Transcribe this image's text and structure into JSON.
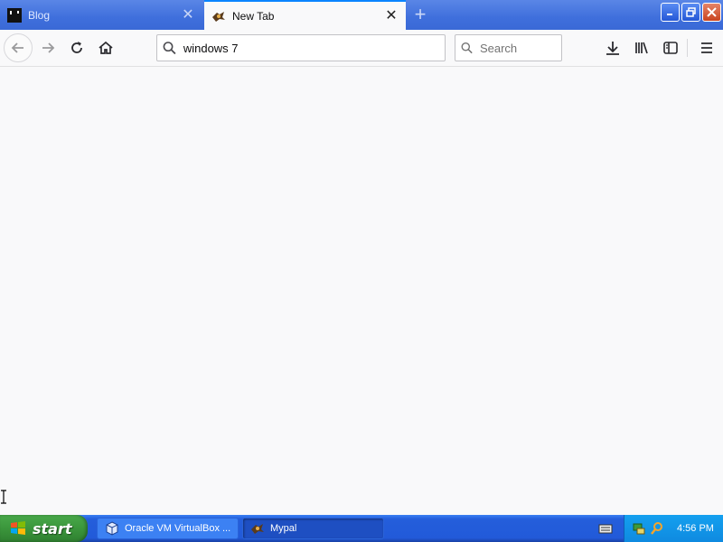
{
  "browser": {
    "tabs": [
      {
        "label": "Blog",
        "active": false,
        "icon": "blog-favicon"
      },
      {
        "label": "New Tab",
        "active": true,
        "icon": "mypal-favicon"
      }
    ],
    "urlbar": {
      "value": "windows 7"
    },
    "searchbar": {
      "placeholder": "Search"
    }
  },
  "taskbar": {
    "start_label": "start",
    "tasks": [
      {
        "label": "Oracle VM VirtualBox ...",
        "icon": "virtualbox-icon"
      },
      {
        "label": "Mypal",
        "icon": "mypal-icon",
        "active": true
      }
    ],
    "clock": "4:56 PM"
  },
  "colors": {
    "accent": "#0a84ff",
    "taskbar": "#245edb",
    "start": "#3b963c"
  }
}
